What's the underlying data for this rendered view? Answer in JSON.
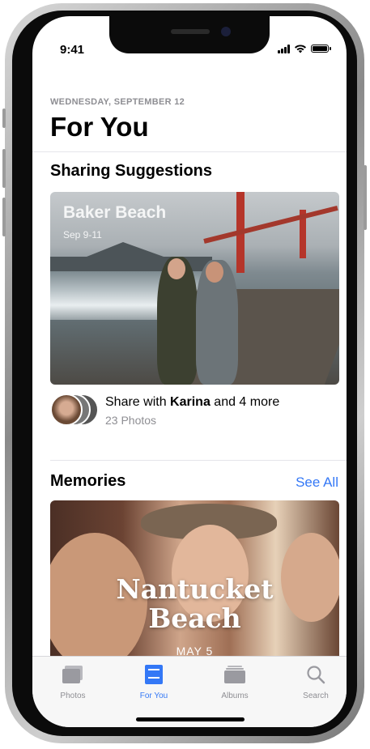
{
  "status_bar": {
    "time": "9:41"
  },
  "header": {
    "date": "WEDNESDAY, SEPTEMBER 12",
    "title": "For You"
  },
  "sharing_suggestions": {
    "section_title": "Sharing Suggestions",
    "card": {
      "title": "Baker Beach",
      "dates": "Sep 9-11"
    },
    "share_prefix": "Share with ",
    "share_name": "Karina",
    "share_suffix": " and 4 more",
    "photo_count": "23 Photos"
  },
  "memories": {
    "section_title": "Memories",
    "see_all": "See All",
    "card": {
      "title_line1": "Nantucket",
      "title_line2": "Beach",
      "date": "MAY 5"
    }
  },
  "tab_bar": {
    "tabs": [
      {
        "label": "Photos",
        "icon": "photos-icon",
        "active": false
      },
      {
        "label": "For You",
        "icon": "for-you-icon",
        "active": true
      },
      {
        "label": "Albums",
        "icon": "albums-icon",
        "active": false
      },
      {
        "label": "Search",
        "icon": "search-icon",
        "active": false
      }
    ]
  },
  "colors": {
    "accent": "#3478f6",
    "secondary_text": "#8e8e93"
  }
}
